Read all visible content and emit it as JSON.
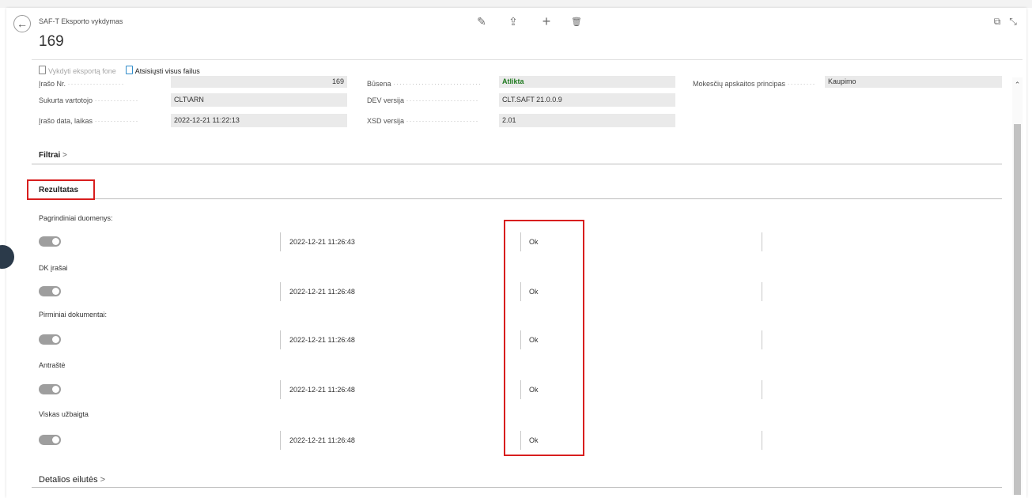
{
  "header": {
    "breadcrumb": "SAF-T Eksporto vykdymas",
    "title": "169"
  },
  "toolbar": {
    "edit_icon": "✎",
    "share_icon": "⇪",
    "add_icon": "+",
    "delete_icon": "🗑",
    "popout_icon": "⧉",
    "collapse_icon": "⤡"
  },
  "actions": {
    "run_background": "Vykdyti eksportą fone",
    "download_all": "Atsisiųsti visus failus"
  },
  "fields": {
    "record_no_label": "Įrašo Nr.",
    "record_no_value": "169",
    "created_by_label": "Sukurta vartotojo",
    "created_by_value": "CLT\\ARN",
    "record_datetime_label": "Įrašo data, laikas",
    "record_datetime_value": "2022-12-21 11:22:13",
    "status_label": "Būsena",
    "status_value": "Atlikta",
    "dev_version_label": "DEV versija",
    "dev_version_value": "CLT.SAFT 21.0.0.9",
    "xsd_version_label": "XSD versija",
    "xsd_version_value": "2.01",
    "tax_principle_label": "Mokesčių apskaitos principas",
    "tax_principle_value": "Kaupimo"
  },
  "sections": {
    "filters": "Filtrai",
    "result": "Rezultatas",
    "details": "Detalios eilutės"
  },
  "results": [
    {
      "label": "Pagrindiniai duomenys:",
      "timestamp": "2022-12-21 11:26:43",
      "status": "Ok"
    },
    {
      "label": "DK įrašai",
      "timestamp": "2022-12-21 11:26:48",
      "status": "Ok"
    },
    {
      "label": "Pirminiai dokumentai:",
      "timestamp": "2022-12-21 11:26:48",
      "status": "Ok"
    },
    {
      "label": "Antraštė",
      "timestamp": "2022-12-21 11:26:48",
      "status": "Ok"
    },
    {
      "label": "Viskas užbaigta",
      "timestamp": "2022-12-21 11:26:48",
      "status": "Ok"
    }
  ],
  "colors": {
    "highlight": "#d81e1e",
    "status_ok": "#1f7a1f"
  }
}
